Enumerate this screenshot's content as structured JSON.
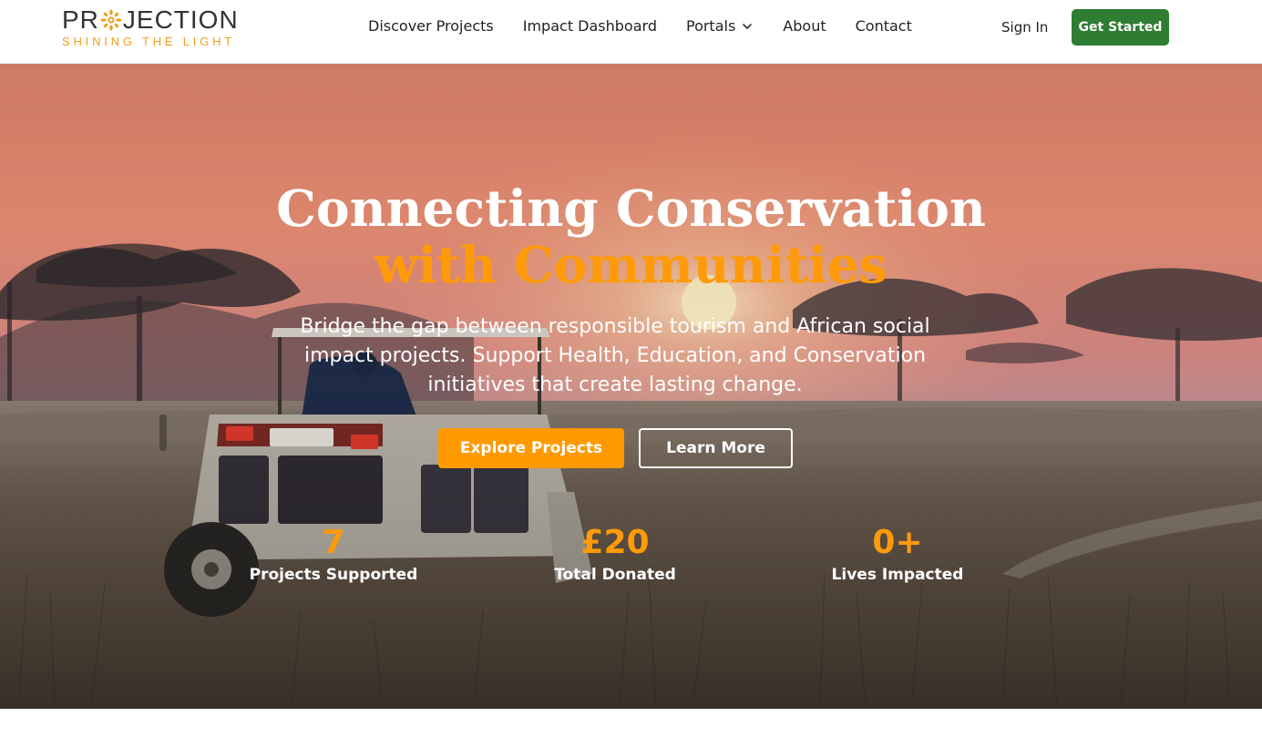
{
  "brand": {
    "name_left": "PR",
    "name_right": "JECTION",
    "tagline": "SHINING THE LIGHT",
    "accent_color": "#f0a01a",
    "icon": "sun-logo-icon"
  },
  "nav": {
    "items": [
      {
        "label": "Discover Projects"
      },
      {
        "label": "Impact Dashboard"
      },
      {
        "label": "Portals",
        "icon": "chevron-down-icon"
      },
      {
        "label": "About"
      },
      {
        "label": "Contact"
      }
    ],
    "sign_in": "Sign In",
    "get_started": "Get Started",
    "cta_color": "#2e7d32"
  },
  "hero": {
    "title_line1": "Connecting Conservation",
    "title_line2": "with Communities",
    "subtitle": "Bridge the gap between responsible tourism and African social impact projects. Support Health, Education, and Conservation initiatives that create lasting change.",
    "primary_button": "Explore Projects",
    "secondary_button": "Learn More",
    "primary_color": "#ff9900",
    "background": "safari sunset scene with vehicle",
    "stats": [
      {
        "value": "7",
        "label": "Projects Supported"
      },
      {
        "value": "£20",
        "label": "Total Donated"
      },
      {
        "value": "0+",
        "label": "Lives Impacted"
      }
    ]
  }
}
